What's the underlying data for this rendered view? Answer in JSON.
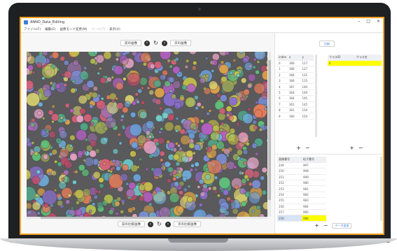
{
  "window": {
    "title": "ANNO_Data_Editing",
    "controls": [
      "–",
      "□",
      "×"
    ]
  },
  "menu": {
    "items": [
      "ファイル(F)",
      "編集(E)",
      "画像モード変更(M)",
      "ツール(T)",
      "表示(V)"
    ]
  },
  "toolbar_top": {
    "prev_label": "前の画像",
    "next_label": "次の画像"
  },
  "toolbar_bottom": {
    "prev_label": "前の比較画像",
    "next_label": "次の比較画像"
  },
  "right": {
    "top_button": "比較",
    "grid_headers": [
      "index",
      "x",
      "y"
    ],
    "grid_rows": [
      [
        "0",
        "366",
        "127"
      ],
      [
        "1",
        "366",
        "127"
      ],
      [
        "2",
        "366",
        "135"
      ],
      [
        "3",
        "366",
        "135"
      ],
      [
        "4",
        "367",
        "140"
      ],
      [
        "5",
        "364",
        "140"
      ],
      [
        "6",
        "364",
        "145"
      ],
      [
        "7",
        "361",
        "145"
      ],
      [
        "8",
        "361",
        "150"
      ],
      [
        "9",
        "360",
        "150"
      ]
    ],
    "class_headers": [
      "クラスID",
      "クラス名"
    ],
    "class_rows": [
      [
        "0",
        ""
      ]
    ],
    "anno_headers": [
      "画像番号",
      "粒子番号"
    ],
    "anno_rows": [
      [
        "249",
        "997"
      ],
      [
        "250",
        "998"
      ],
      [
        "251",
        "999"
      ],
      [
        "252",
        "980"
      ],
      [
        "253",
        "981"
      ],
      [
        "254",
        "982"
      ],
      [
        "255",
        "983"
      ],
      [
        "256",
        "984"
      ],
      [
        "257",
        "985"
      ],
      [
        "258",
        "986"
      ]
    ],
    "add_link": "データ追加"
  },
  "colors": {
    "accent": "#f4a020",
    "highlight": "#ffff00",
    "link": "#3b7fd6"
  }
}
